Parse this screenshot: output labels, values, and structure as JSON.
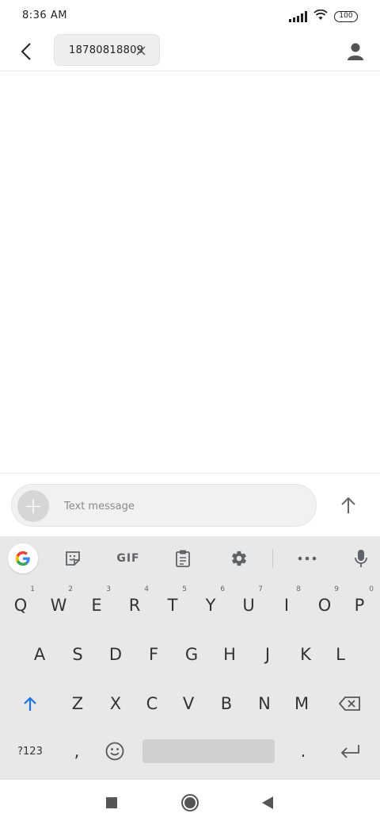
{
  "status_bar": {
    "time": "8:36 AM",
    "battery": "100"
  },
  "header": {
    "recipient": "18780818809"
  },
  "compose": {
    "placeholder": "Text message"
  },
  "keyboard": {
    "toolbar": {
      "gif_label": "GIF"
    },
    "row1": [
      {
        "key": "Q",
        "hint": "1"
      },
      {
        "key": "W",
        "hint": "2"
      },
      {
        "key": "E",
        "hint": "3"
      },
      {
        "key": "R",
        "hint": "4"
      },
      {
        "key": "T",
        "hint": "5"
      },
      {
        "key": "Y",
        "hint": "6"
      },
      {
        "key": "U",
        "hint": "7"
      },
      {
        "key": "I",
        "hint": "8"
      },
      {
        "key": "O",
        "hint": "9"
      },
      {
        "key": "P",
        "hint": "0"
      }
    ],
    "row2": [
      "A",
      "S",
      "D",
      "F",
      "G",
      "H",
      "J",
      "K",
      "L"
    ],
    "row3": [
      "Z",
      "X",
      "C",
      "V",
      "B",
      "N",
      "M"
    ],
    "symbols_label": "?123",
    "comma": ",",
    "period": "."
  },
  "colors": {
    "shift_accent": "#1a73e8",
    "keyboard_bg": "#e8e8e8"
  }
}
